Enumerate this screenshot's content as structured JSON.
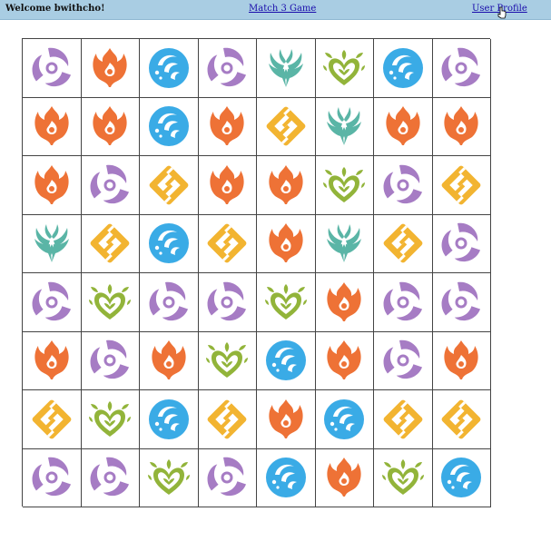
{
  "topbar": {
    "welcome_text": "Welcome bwithcho!",
    "game_link": "Match 3 Game",
    "profile_link": "User Profile"
  },
  "board": {
    "rows": 8,
    "cols": 8,
    "cells": [
      [
        "electro",
        "pyro",
        "hydro",
        "electro",
        "anemo",
        "dendro",
        "hydro",
        "electro"
      ],
      [
        "pyro",
        "pyro",
        "hydro",
        "pyro",
        "geo",
        "anemo",
        "pyro",
        "pyro"
      ],
      [
        "pyro",
        "electro",
        "geo",
        "pyro",
        "pyro",
        "dendro",
        "electro",
        "geo"
      ],
      [
        "anemo",
        "geo",
        "hydro",
        "geo",
        "pyro",
        "anemo",
        "geo",
        "electro"
      ],
      [
        "electro",
        "dendro",
        "electro",
        "electro",
        "dendro",
        "pyro",
        "electro",
        "electro"
      ],
      [
        "pyro",
        "electro",
        "pyro",
        "dendro",
        "hydro",
        "pyro",
        "electro",
        "pyro"
      ],
      [
        "geo",
        "dendro",
        "hydro",
        "geo",
        "pyro",
        "hydro",
        "geo",
        "geo"
      ],
      [
        "electro",
        "electro",
        "dendro",
        "electro",
        "hydro",
        "pyro",
        "dendro",
        "hydro"
      ]
    ]
  },
  "colors": {
    "topbar_bg": "#a9cde3",
    "pyro": "#ee7236",
    "hydro": "#3aabe6",
    "electro": "#a67cc4",
    "anemo": "#5ab5a6",
    "geo": "#f2b431",
    "dendro": "#92b43a"
  }
}
